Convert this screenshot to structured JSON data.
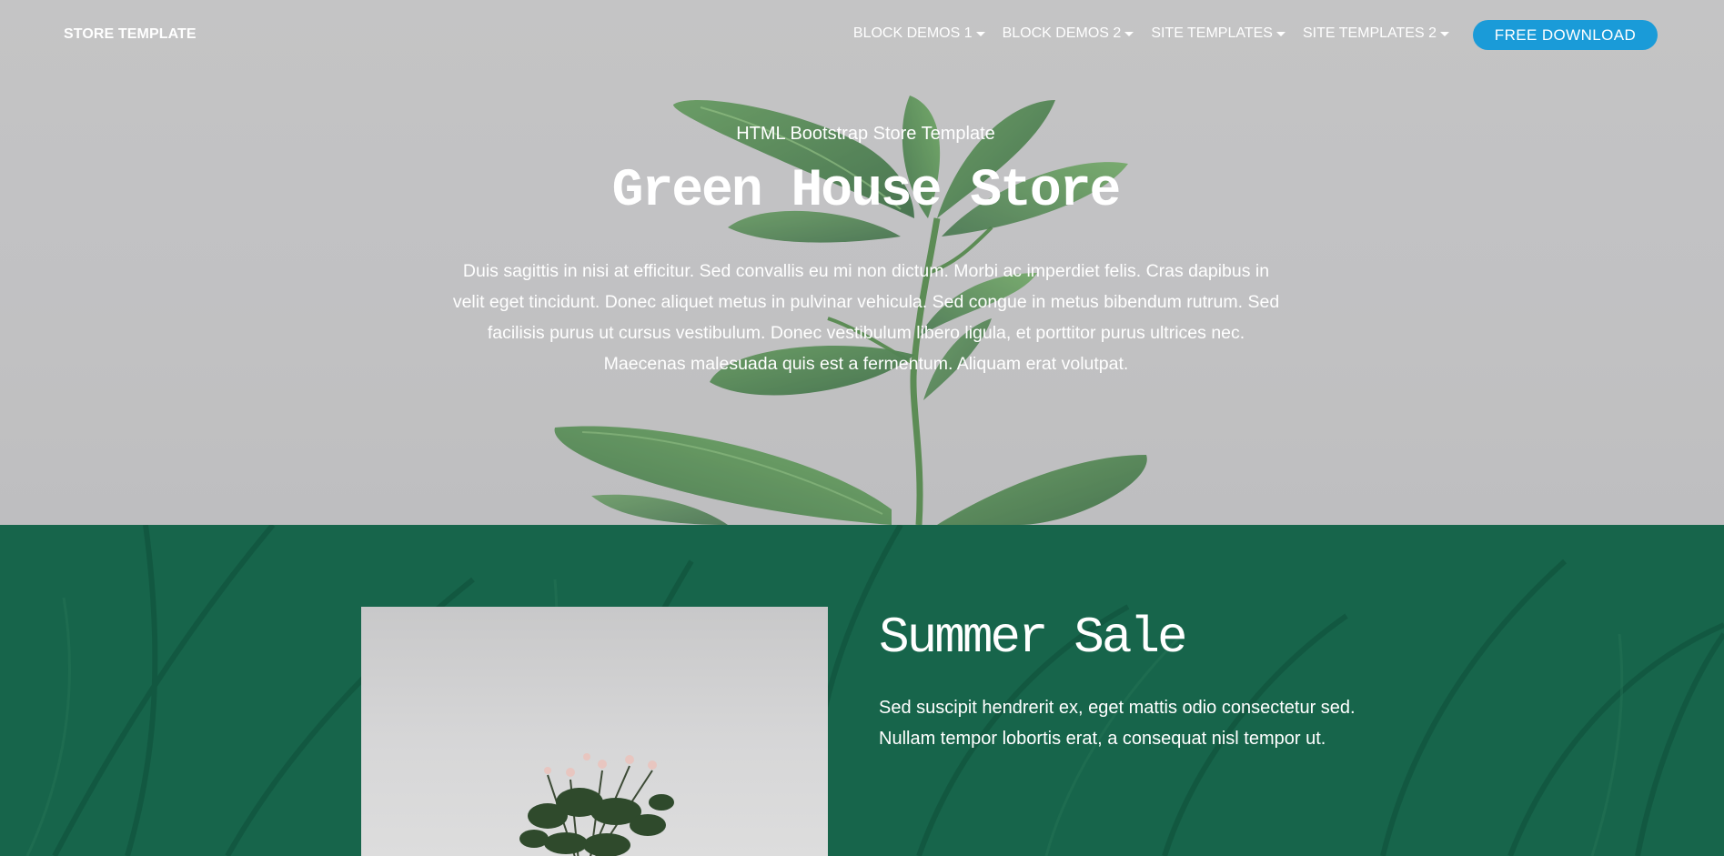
{
  "navbar": {
    "brand": "STORE TEMPLATE",
    "menu": [
      {
        "label": "BLOCK DEMOS 1"
      },
      {
        "label": "BLOCK DEMOS 2"
      },
      {
        "label": "SITE TEMPLATES"
      },
      {
        "label": "SITE TEMPLATES 2"
      }
    ],
    "cta_label": "FREE DOWNLOAD",
    "cta_color": "#1a9bd8"
  },
  "hero": {
    "subtitle": "HTML Bootstrap Store Template",
    "title": "Green House Store",
    "text": "Duis sagittis in nisi at efficitur. Sed convallis eu mi non dictum. Morbi ac imperdiet felis. Cras dapibus in velit eget tincidunt. Donec aliquet metus in pulvinar vehicula. Sed congue in metus bibendum rutrum. Sed facilisis purus ut cursus vestibulum. Donec vestibulum libero ligula, et porttitor purus ultrices nec. Maecenas malesuada quis est a fermentum. Aliquam erat volutpat.",
    "background_color": "#c2c2c4"
  },
  "sale": {
    "heading": "Summer Sale",
    "text": "Sed suscipit hendrerit ex, eget mattis odio consectetur sed. Nullam tempor lobortis erat, a consequat nisl tempor ut.",
    "background_color": "#17654b"
  }
}
